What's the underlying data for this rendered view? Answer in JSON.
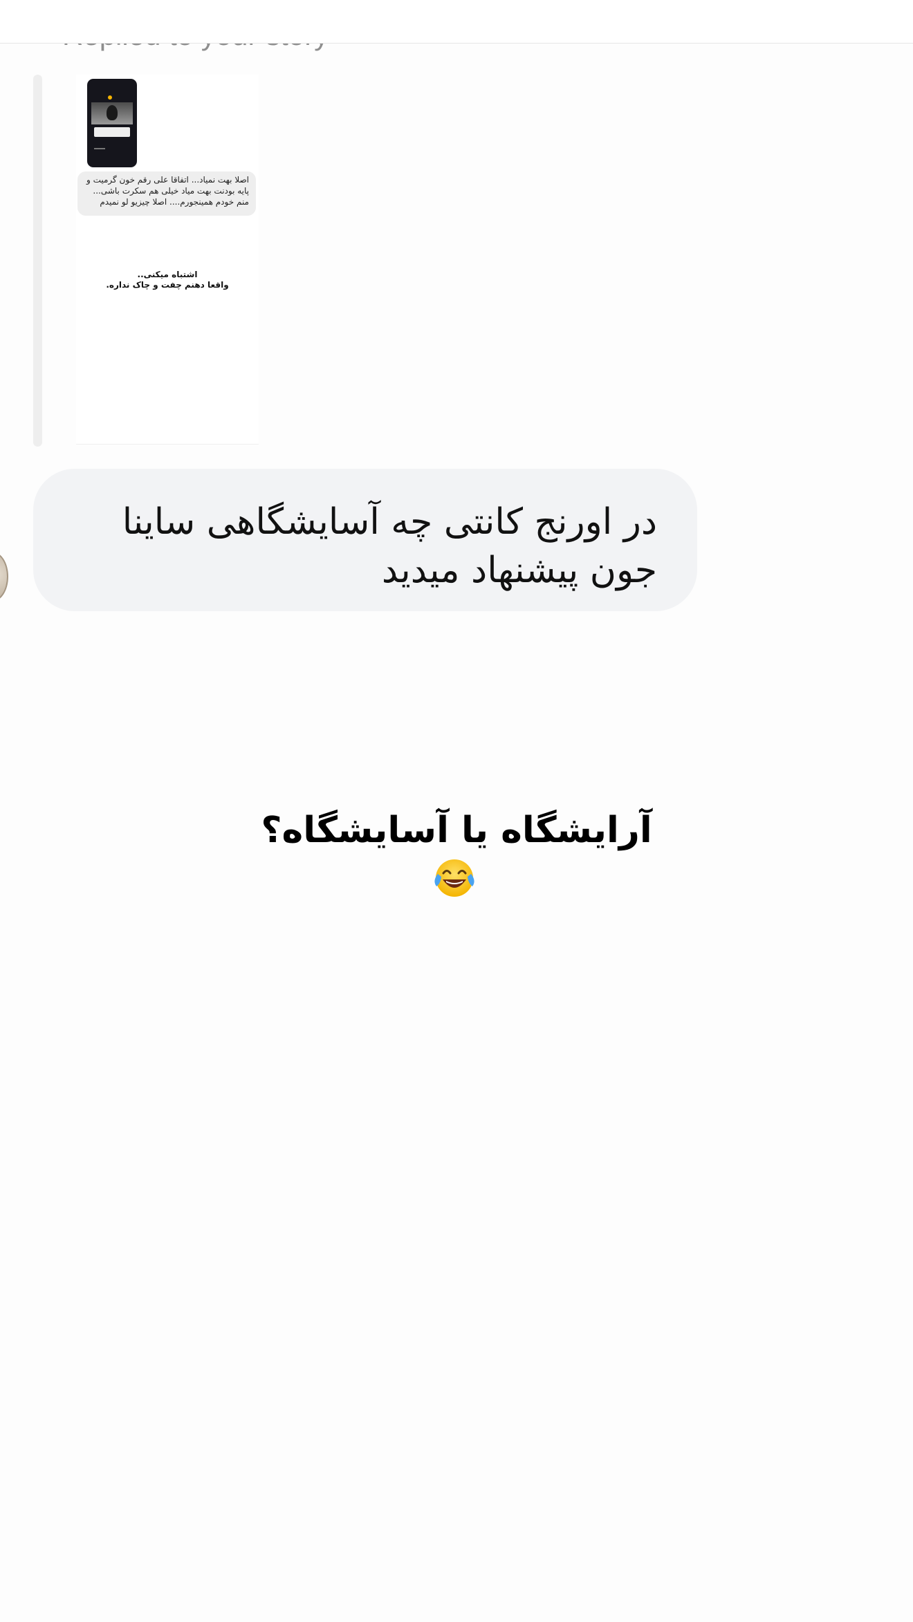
{
  "reply_header": {
    "label": "Replied to your story"
  },
  "story_preview": {
    "comment_lines": [
      "اصلا بهت نمیاد... اتفاقا علی رقم خون گرمیت و",
      "پایه بودنت بهت میاد خیلی هم سکرت باشی...",
      "منم خودم همینجورم.... اصلا چیزیو لو نمیدم"
    ],
    "sticker_lines": [
      "اشتباه میکنی..",
      "واقعا دهنم چفت و چاک نداره."
    ]
  },
  "message": {
    "text": "در اورنج کانتی چه آسایشگاهی ساینا جون پیشنهاد میدید"
  },
  "overlay": {
    "text": "آرایشگاه یا آسایشگاه؟",
    "emoji_icon": "face-with-tears-of-joy-icon"
  }
}
